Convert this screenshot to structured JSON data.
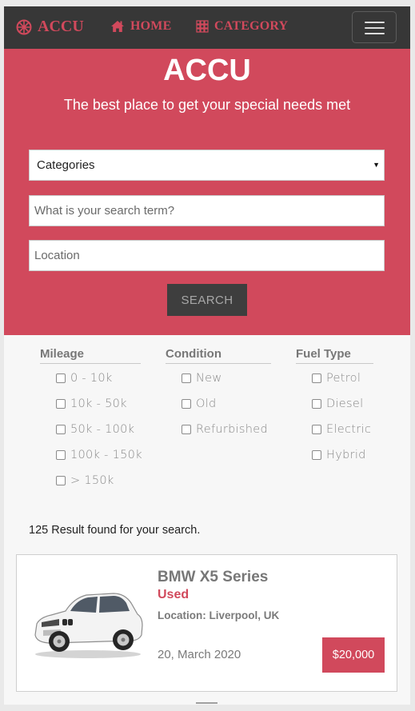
{
  "navbar": {
    "brand": "ACCU",
    "brand_icon": "dharma-wheel-icon",
    "links": [
      {
        "label": "HOME",
        "icon": "home-icon"
      },
      {
        "label": "CATEGORY",
        "icon": "grid-icon"
      }
    ],
    "toggler_icon": "hamburger-icon"
  },
  "hero": {
    "title": "ACCU",
    "subtitle": "The best place to get your special needs met",
    "category_select": "Categories",
    "search_placeholder": "What is your search term?",
    "location_placeholder": "Location",
    "search_button": "SEARCH"
  },
  "filters": {
    "mileage": {
      "heading": "Mileage",
      "options": [
        "0 - 10k",
        "10k - 50k",
        "50k - 100k",
        "100k - 150k",
        "> 150k"
      ]
    },
    "condition": {
      "heading": "Condition",
      "options": [
        "New",
        "Old",
        "Refurbished"
      ]
    },
    "fuel": {
      "heading": "Fuel Type",
      "options": [
        "Petrol",
        "Diesel",
        "Electric",
        "Hybrid"
      ]
    }
  },
  "results": {
    "count_text": "125 Result found for your search."
  },
  "listing": {
    "title": "BMW X5 Series",
    "condition": "Used",
    "location": "Location: Liverpool, UK",
    "date": "20, March 2020",
    "price": "$20,000"
  },
  "colors": {
    "accent": "#d1495c",
    "navbar": "#373737",
    "button_dark": "#3e3e3e"
  }
}
